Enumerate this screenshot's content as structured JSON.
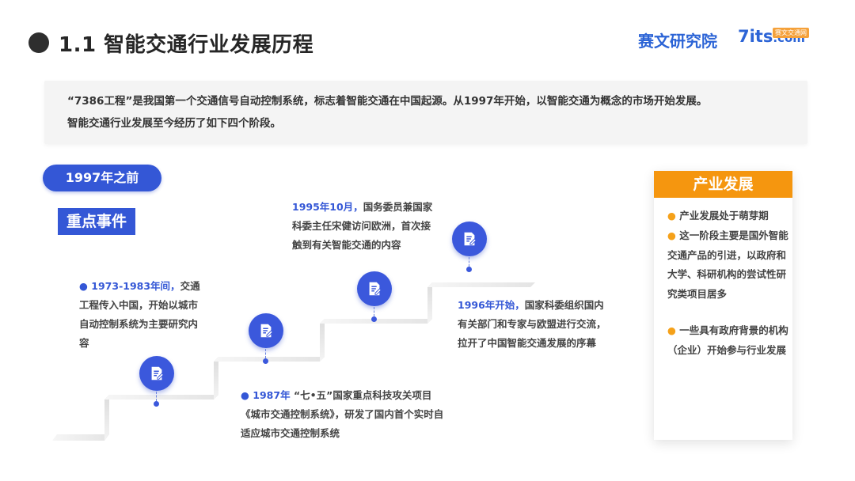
{
  "header": {
    "title": "1.1 智能交通行业发展历程",
    "brand_cn": "赛文研究院",
    "brand_7its": "7its",
    "brand_com": ".com",
    "brand_badge": "赛文交通网"
  },
  "intro": {
    "line1": "“7386工程”是我国第一个交通信号自动控制系统，标志着智能交通在中国起源。从1997年开始，以智能交通为概念的市场开始发展。",
    "line2": "智能交通行业发展至今经历了如下四个阶段。"
  },
  "era_label": "1997年之前",
  "key_events_label": "重点事件",
  "events": [
    {
      "bullet": "●",
      "highlight": "1973-1983年间，",
      "body": "交通工程传入中国，开始以城市自动控制系统为主要研究内容"
    },
    {
      "bullet": "●",
      "highlight": "1987年",
      "body": "“七•五”国家重点科技攻关项目《城市交通控制系统》，研发了国内首个实时自适应城市交通控制系统"
    },
    {
      "bullet": "",
      "highlight": "1995年10月，",
      "body": "国务委员兼国家科委主任宋健访问欧洲，首次接触到有关智能交通的内容"
    },
    {
      "bullet": "",
      "highlight": "1996年开始，",
      "body": "国家科委组织国内有关部门和专家与欧盟进行交流，拉开了中国智能交通发展的序幕"
    }
  ],
  "panel": {
    "title": "产业发展",
    "bullet": "●",
    "items": [
      "产业发展处于萌芽期",
      "这一阶段主要是国外智能交通产品的引进，以政府和大学、科研机构的尝试性研究类项目居多",
      "一些具有政府背景的机构（企业）开始参与行业发展"
    ]
  },
  "icons": {
    "event": "edit-note-icon"
  },
  "colors": {
    "primary": "#3457d6",
    "accent": "#f5960f"
  }
}
